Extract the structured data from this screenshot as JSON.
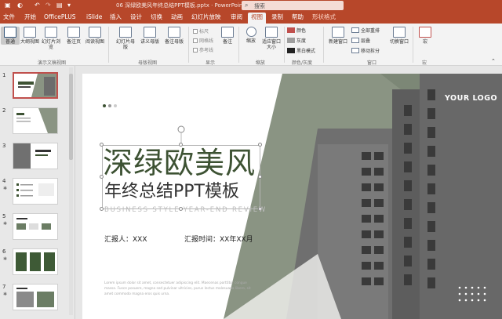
{
  "titlebar": {
    "autosave_icon": "save-icon",
    "undo_icon": "undo-icon",
    "redo_icon": "redo-icon",
    "document_title": "06 深绿欧美风年终总结PPT模板.pptx  ·  PowerPoint",
    "search_placeholder": "搜索"
  },
  "tabs": [
    {
      "label": "文件"
    },
    {
      "label": "开始"
    },
    {
      "label": "OfficePLUS"
    },
    {
      "label": "iSlide"
    },
    {
      "label": "插入"
    },
    {
      "label": "设计"
    },
    {
      "label": "切换"
    },
    {
      "label": "动画"
    },
    {
      "label": "幻灯片放映"
    },
    {
      "label": "审阅"
    },
    {
      "label": "视图",
      "active": true
    },
    {
      "label": "录制"
    },
    {
      "label": "帮助"
    },
    {
      "label": "形状格式",
      "contextual": true
    }
  ],
  "ribbon": {
    "views": {
      "group_label": "演示文稿视图",
      "buttons": [
        "普通",
        "大纲视图",
        "幻灯片浏览",
        "备注页",
        "阅读视图"
      ]
    },
    "masters": {
      "group_label": "母版视图",
      "buttons": [
        "幻灯片母版",
        "讲义母版",
        "备注母版"
      ]
    },
    "show": {
      "group_label": "显示",
      "checks": [
        "标尺",
        "网格线",
        "参考线"
      ],
      "notes_button": "备注"
    },
    "zoom": {
      "group_label": "缩放",
      "buttons": [
        "缩放",
        "适应窗口大小"
      ]
    },
    "color": {
      "group_label": "颜色/灰度",
      "items": [
        "颜色",
        "灰度",
        "黑白模式"
      ],
      "color_swatch": "#c0504d",
      "gray_swatch": "#9e9e9e",
      "bw_swatch": "#222222"
    },
    "window": {
      "group_label": "窗口",
      "buttons": [
        "新建窗口",
        "全部重排",
        "层叠",
        "移动拆分",
        "切换窗口"
      ]
    },
    "macro": {
      "group_label": "宏",
      "button": "宏"
    }
  },
  "thumbnails": [
    {
      "num": "1",
      "selected": true
    },
    {
      "num": "2"
    },
    {
      "num": "3"
    },
    {
      "num": "4"
    },
    {
      "num": "5"
    },
    {
      "num": "6"
    },
    {
      "num": "7"
    }
  ],
  "slide": {
    "title": "深绿欧美风",
    "subtitle": "年终总结PPT模板",
    "english_subtitle": "BUSINESS STYLE YEAR-END REVIEW",
    "reporter": "汇报人：XXX",
    "report_time": "汇报时间：XX年XX月",
    "logo": "YOUR LOGO",
    "body_text": "Lorem ipsum dolor sit amet, consectetuer adipiscing elit. Maecenas porttitor congue massa. Fusce posuere, magna sed pulvinar ultricies, purus lectus malesuada libero, sit amet commodo magna eros quis urna.",
    "accent_color": "#6b7d64",
    "dark_green": "#3e5a36",
    "title_color": "#3d5233"
  }
}
